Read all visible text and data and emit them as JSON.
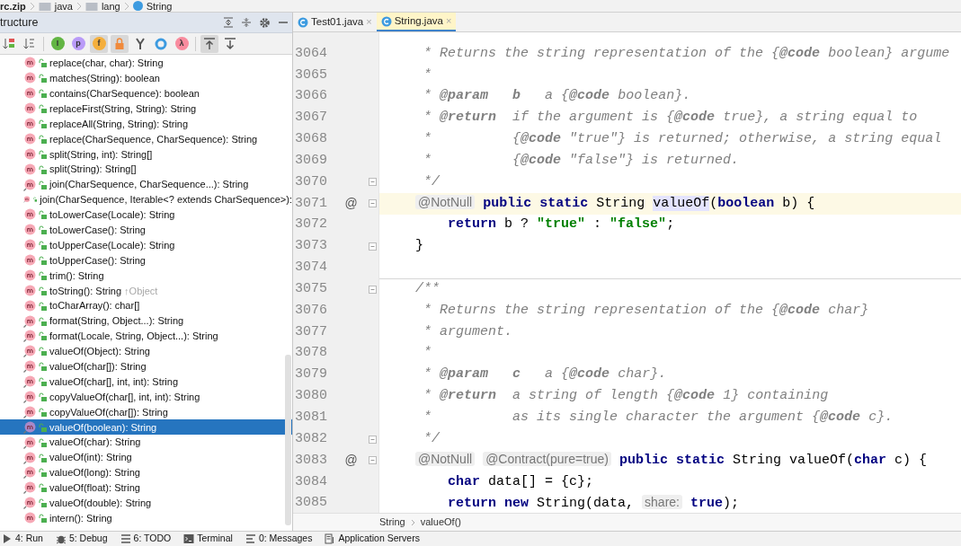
{
  "navbar": {
    "crumbs": [
      {
        "kind": "archive",
        "label": "rc.zip"
      },
      {
        "kind": "folder",
        "label": "java"
      },
      {
        "kind": "folder",
        "label": "lang"
      },
      {
        "kind": "class",
        "label": "String"
      }
    ]
  },
  "structure": {
    "title": "tructure",
    "toolbar": [
      {
        "kind": "sort-visibility",
        "on": false
      },
      {
        "kind": "sort-alpha",
        "on": false
      },
      {
        "kind": "badge",
        "glyph": "I",
        "color": "#62b543",
        "on": false
      },
      {
        "kind": "badge",
        "glyph": "p",
        "color": "#b99bf8",
        "on": false
      },
      {
        "kind": "badge",
        "glyph": "f",
        "color": "#f4af3d",
        "on": true
      },
      {
        "kind": "lock",
        "on": true
      },
      {
        "kind": "fork",
        "on": false
      },
      {
        "kind": "ring",
        "on": false
      },
      {
        "kind": "badge",
        "glyph": "λ",
        "color": "#f98b9e",
        "on": false
      },
      {
        "kind": "scroll-from",
        "on": true
      },
      {
        "kind": "scroll-to",
        "on": false
      }
    ],
    "items": [
      {
        "label": "replace(char, char): String",
        "static": false,
        "selected": false
      },
      {
        "label": "matches(String): boolean",
        "static": false,
        "selected": false
      },
      {
        "label": "contains(CharSequence): boolean",
        "static": false,
        "selected": false
      },
      {
        "label": "replaceFirst(String, String): String",
        "static": false,
        "selected": false
      },
      {
        "label": "replaceAll(String, String): String",
        "static": false,
        "selected": false
      },
      {
        "label": "replace(CharSequence, CharSequence): String",
        "static": false,
        "selected": false
      },
      {
        "label": "split(String, int): String[]",
        "static": false,
        "selected": false
      },
      {
        "label": "split(String): String[]",
        "static": false,
        "selected": false
      },
      {
        "label": "join(CharSequence, CharSequence...): String",
        "static": true,
        "selected": false
      },
      {
        "label": "join(CharSequence, Iterable<? extends CharSequence>):",
        "static": true,
        "selected": false
      },
      {
        "label": "toLowerCase(Locale): String",
        "static": false,
        "selected": false
      },
      {
        "label": "toLowerCase(): String",
        "static": false,
        "selected": false
      },
      {
        "label": "toUpperCase(Locale): String",
        "static": false,
        "selected": false
      },
      {
        "label": "toUpperCase(): String",
        "static": false,
        "selected": false
      },
      {
        "label": "trim(): String",
        "static": false,
        "selected": false
      },
      {
        "label": "toString(): String",
        "suffix": "↑Object",
        "static": false,
        "selected": false
      },
      {
        "label": "toCharArray(): char[]",
        "static": false,
        "selected": false
      },
      {
        "label": "format(String, Object...): String",
        "static": true,
        "selected": false
      },
      {
        "label": "format(Locale, String, Object...): String",
        "static": true,
        "selected": false
      },
      {
        "label": "valueOf(Object): String",
        "static": true,
        "selected": false
      },
      {
        "label": "valueOf(char[]): String",
        "static": true,
        "selected": false
      },
      {
        "label": "valueOf(char[], int, int): String",
        "static": true,
        "selected": false
      },
      {
        "label": "copyValueOf(char[], int, int): String",
        "static": true,
        "selected": false
      },
      {
        "label": "copyValueOf(char[]): String",
        "static": true,
        "selected": false
      },
      {
        "label": "valueOf(boolean): String",
        "static": true,
        "selected": true
      },
      {
        "label": "valueOf(char): String",
        "static": true,
        "selected": false
      },
      {
        "label": "valueOf(int): String",
        "static": true,
        "selected": false
      },
      {
        "label": "valueOf(long): String",
        "static": true,
        "selected": false
      },
      {
        "label": "valueOf(float): String",
        "static": true,
        "selected": false
      },
      {
        "label": "valueOf(double): String",
        "static": true,
        "selected": false
      },
      {
        "label": "intern(): String",
        "static": false,
        "selected": false
      }
    ]
  },
  "tabs": [
    {
      "label": "Test01.java",
      "close": "×",
      "selected": false
    },
    {
      "label": "String.java",
      "close": "×",
      "selected": true
    }
  ],
  "editor": {
    "lines": [
      {
        "number": "3064",
        "tokens": [
          {
            "kind": "comment",
            "text": "     * Returns the string representation of the {"
          },
          {
            "kind": "doctag",
            "text": "@code"
          },
          {
            "kind": "comment",
            "text": " boolean} argume"
          }
        ]
      },
      {
        "number": "3065",
        "tokens": [
          {
            "kind": "comment",
            "text": "     *"
          }
        ]
      },
      {
        "number": "3066",
        "tokens": [
          {
            "kind": "comment",
            "text": "     * "
          },
          {
            "kind": "doctag",
            "text": "@param"
          },
          {
            "kind": "doctag",
            "text": "   b"
          },
          {
            "kind": "comment",
            "text": "   a {"
          },
          {
            "kind": "doctag",
            "text": "@code"
          },
          {
            "kind": "comment",
            "text": " boolean}."
          }
        ]
      },
      {
        "number": "3067",
        "tokens": [
          {
            "kind": "comment",
            "text": "     * "
          },
          {
            "kind": "doctag",
            "text": "@return"
          },
          {
            "kind": "comment",
            "text": "  if the argument is {"
          },
          {
            "kind": "doctag",
            "text": "@code"
          },
          {
            "kind": "comment",
            "text": " true}, a string equal to"
          }
        ]
      },
      {
        "number": "3068",
        "tokens": [
          {
            "kind": "comment",
            "text": "     *          {"
          },
          {
            "kind": "doctag",
            "text": "@code"
          },
          {
            "kind": "comment",
            "text": " \"true\"} is returned; otherwise, a string equal"
          }
        ]
      },
      {
        "number": "3069",
        "tokens": [
          {
            "kind": "comment",
            "text": "     *          {"
          },
          {
            "kind": "doctag",
            "text": "@code"
          },
          {
            "kind": "comment",
            "text": " \"false\"} is returned."
          }
        ]
      },
      {
        "number": "3070",
        "fold": true,
        "tokens": [
          {
            "kind": "comment",
            "text": "     */"
          }
        ]
      },
      {
        "number": "3071",
        "marker": "@",
        "fold": true,
        "current": true,
        "tokens": [
          {
            "kind": "annotation",
            "text": "    @NotNull"
          },
          {
            "kind": "keyword",
            "text": " public static"
          },
          {
            "kind": "plain",
            "text": " String "
          },
          {
            "kind": "highlight",
            "text": "valueOf"
          },
          {
            "kind": "plain",
            "text": "("
          },
          {
            "kind": "keyword",
            "text": "boolean"
          },
          {
            "kind": "plain",
            "text": " b) {"
          }
        ]
      },
      {
        "number": "3072",
        "tokens": [
          {
            "kind": "keyword",
            "text": "        return"
          },
          {
            "kind": "plain",
            "text": " b ? "
          },
          {
            "kind": "string",
            "text": "\"true\""
          },
          {
            "kind": "plain",
            "text": " : "
          },
          {
            "kind": "string",
            "text": "\"false\""
          },
          {
            "kind": "plain",
            "text": ";"
          }
        ]
      },
      {
        "number": "3073",
        "fold": true,
        "tokens": [
          {
            "kind": "plain",
            "text": "    }"
          }
        ]
      },
      {
        "number": "3074"
      },
      {
        "number": "3075",
        "fold": true,
        "separator": true,
        "tokens": [
          {
            "kind": "comment",
            "text": "    /**"
          }
        ]
      },
      {
        "number": "3076",
        "tokens": [
          {
            "kind": "comment",
            "text": "     * Returns the string representation of the {"
          },
          {
            "kind": "doctag",
            "text": "@code"
          },
          {
            "kind": "comment",
            "text": " char}"
          }
        ]
      },
      {
        "number": "3077",
        "tokens": [
          {
            "kind": "comment",
            "text": "     * argument."
          }
        ]
      },
      {
        "number": "3078",
        "tokens": [
          {
            "kind": "comment",
            "text": "     *"
          }
        ]
      },
      {
        "number": "3079",
        "tokens": [
          {
            "kind": "comment",
            "text": "     * "
          },
          {
            "kind": "doctag",
            "text": "@param"
          },
          {
            "kind": "doctag",
            "text": "   c"
          },
          {
            "kind": "comment",
            "text": "   a {"
          },
          {
            "kind": "doctag",
            "text": "@code"
          },
          {
            "kind": "comment",
            "text": " char}."
          }
        ]
      },
      {
        "number": "3080",
        "tokens": [
          {
            "kind": "comment",
            "text": "     * "
          },
          {
            "kind": "doctag",
            "text": "@return"
          },
          {
            "kind": "comment",
            "text": "  a string of length {"
          },
          {
            "kind": "doctag",
            "text": "@code"
          },
          {
            "kind": "comment",
            "text": " 1} containing"
          }
        ]
      },
      {
        "number": "3081",
        "tokens": [
          {
            "kind": "comment",
            "text": "     *          as its single character the argument {"
          },
          {
            "kind": "doctag",
            "text": "@code"
          },
          {
            "kind": "comment",
            "text": " c}."
          }
        ]
      },
      {
        "number": "3082",
        "fold": true,
        "tokens": [
          {
            "kind": "comment",
            "text": "     */"
          }
        ]
      },
      {
        "number": "3083",
        "marker": "@",
        "fold": true,
        "tokens": [
          {
            "kind": "annotation",
            "text": "    @NotNull"
          },
          {
            "kind": "annotation",
            "text": " @Contract(pure=true)"
          },
          {
            "kind": "keyword",
            "text": " public static"
          },
          {
            "kind": "plain",
            "text": " String valueOf("
          },
          {
            "kind": "keyword",
            "text": "char"
          },
          {
            "kind": "plain",
            "text": " c) {"
          }
        ]
      },
      {
        "number": "3084",
        "tokens": [
          {
            "kind": "keyword",
            "text": "        char"
          },
          {
            "kind": "plain",
            "text": " data[] = {c};"
          }
        ]
      },
      {
        "number": "3085",
        "tokens": [
          {
            "kind": "keyword",
            "text": "        return new"
          },
          {
            "kind": "plain",
            "text": " String(data, "
          },
          {
            "kind": "hint",
            "text": "share:"
          },
          {
            "kind": "keyword",
            "text": " true"
          },
          {
            "kind": "plain",
            "text": ");"
          }
        ]
      }
    ],
    "breadcrumbs": [
      "String",
      "valueOf()"
    ]
  },
  "toolwindows": [
    {
      "kind": "run",
      "label": "4: Run"
    },
    {
      "kind": "debug",
      "label": "5: Debug"
    },
    {
      "kind": "todo",
      "label": "6: TODO"
    },
    {
      "kind": "terminal",
      "label": "Terminal"
    },
    {
      "kind": "messages",
      "label": "0: Messages"
    },
    {
      "kind": "servers",
      "label": "Application Servers"
    }
  ]
}
